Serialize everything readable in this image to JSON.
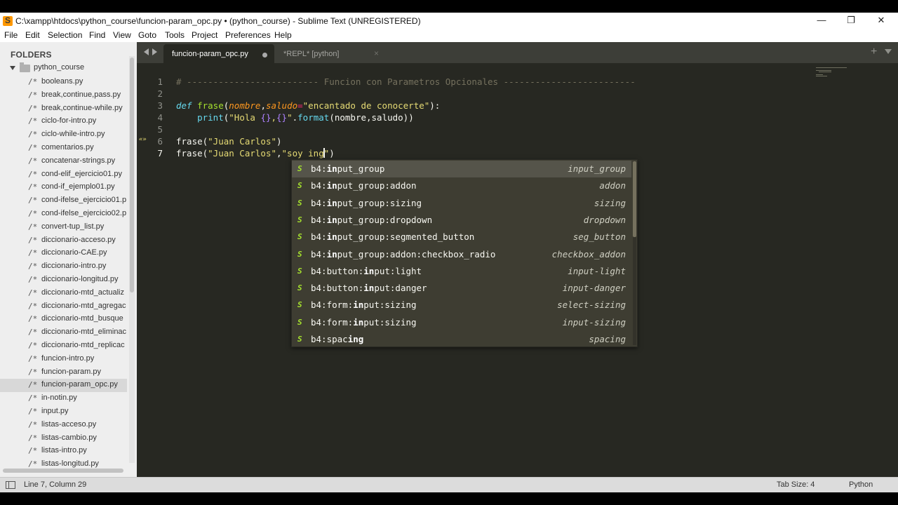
{
  "window": {
    "title": "C:\\xampp\\htdocs\\python_course\\funcion-param_opc.py • (python_course) - Sublime Text (UNREGISTERED)",
    "minimize_glyph": "—",
    "restore_glyph": "❐",
    "close_glyph": "✕"
  },
  "menu": [
    "File",
    "Edit",
    "Selection",
    "Find",
    "View",
    "Goto",
    "Tools",
    "Project",
    "Preferences",
    "Help"
  ],
  "sidebar": {
    "heading": "FOLDERS",
    "project": "python_course",
    "file_glyph": "/*",
    "selected_index": 23,
    "files": [
      "booleans.py",
      "break,continue,pass.py",
      "break,continue-while.py",
      "ciclo-for-intro.py",
      "ciclo-while-intro.py",
      "comentarios.py",
      "concatenar-strings.py",
      "cond-elif_ejercicio01.py",
      "cond-if_ejemplo01.py",
      "cond-ifelse_ejercicio01.p",
      "cond-ifelse_ejercicio02.p",
      "convert-tup_list.py",
      "diccionario-acceso.py",
      "diccionario-CAE.py",
      "diccionario-intro.py",
      "diccionario-longitud.py",
      "diccionario-mtd_actualiz",
      "diccionario-mtd_agregac",
      "diccionario-mtd_busque",
      "diccionario-mtd_eliminac",
      "diccionario-mtd_replicac",
      "funcion-intro.py",
      "funcion-param.py",
      "funcion-param_opc.py",
      "in-notin.py",
      "input.py",
      "listas-acceso.py",
      "listas-cambio.py",
      "listas-intro.py",
      "listas-longitud.py"
    ]
  },
  "tabs": [
    {
      "label": "funcion-param_opc.py",
      "active": true,
      "dirty": true
    },
    {
      "label": "*REPL* [python]",
      "active": false,
      "close_glyph": "×"
    }
  ],
  "tabbar": {
    "new_tab_glyph": "+"
  },
  "editor": {
    "current_line": 7,
    "gutter_marker": "«»",
    "line_numbers": [
      "1",
      "2",
      "3",
      "4",
      "5",
      "6",
      "7"
    ],
    "lines": {
      "l1": "# ------------------------- Funcion con Parametros Opcionales -------------------------",
      "l3_def": "def",
      "l3_name": "frase",
      "l3_open": "(",
      "l3_p1": "nombre",
      "l3_comma": ",",
      "l3_p2": "saludo",
      "l3_eq": "=",
      "l3_str": "\"encantado de conocerte\"",
      "l3_close": "):",
      "l4_indent": "    ",
      "l4_print": "print",
      "l4_open": "(",
      "l4_str_a": "\"Hola ",
      "l4_ph1": "{}",
      "l4_comma_s": ",",
      "l4_ph2": "{}",
      "l4_str_b": "\"",
      "l4_dot": ".",
      "l4_format": "format",
      "l4_args": "(nombre,saludo))",
      "l6_call": "frase(",
      "l6_str": "\"Juan Carlos\"",
      "l6_close": ")",
      "l7_call": "frase(",
      "l7_str1": "\"Juan Carlos\"",
      "l7_comma": ",",
      "l7_str2_a": "\"soy ing",
      "l7_str2_b": "\"",
      "l7_close": ")"
    }
  },
  "autocomplete": {
    "kind": "S",
    "selected_index": 0,
    "items": [
      {
        "pre": "b4:",
        "bold": "in",
        "post": "put_group",
        "desc": "input_group"
      },
      {
        "pre": "b4:",
        "bold": "in",
        "post": "put_group:addon",
        "desc": "addon"
      },
      {
        "pre": "b4:",
        "bold": "in",
        "post": "put_group:sizing",
        "desc": "sizing"
      },
      {
        "pre": "b4:",
        "bold": "in",
        "post": "put_group:dropdown",
        "desc": "dropdown"
      },
      {
        "pre": "b4:",
        "bold": "in",
        "post": "put_group:segmented_button",
        "desc": "seg_button"
      },
      {
        "pre": "b4:",
        "bold": "in",
        "post": "put_group:addon:checkbox_radio",
        "desc": "checkbox_addon"
      },
      {
        "pre": "b4:button:",
        "bold": "in",
        "post": "put:light",
        "desc": "input-light"
      },
      {
        "pre": "b4:button:",
        "bold": "in",
        "post": "put:danger",
        "desc": "input-danger"
      },
      {
        "pre": "b4:form:",
        "bold": "in",
        "post": "put:sizing",
        "desc": "select-sizing"
      },
      {
        "pre": "b4:form:",
        "bold": "in",
        "post": "put:sizing",
        "desc": "input-sizing"
      },
      {
        "pre": "b4:spac",
        "bold": "ing",
        "post": "",
        "desc": "spacing"
      }
    ]
  },
  "statusbar": {
    "position": "Line 7, Column 29",
    "tab_size": "Tab Size: 4",
    "syntax": "Python"
  },
  "colors": {
    "editor_bg": "#272822",
    "comment": "#75715e",
    "keyword": "#66d9ef",
    "function": "#a6e22e",
    "parameter": "#fd971f",
    "operator": "#f92672",
    "string": "#e6db74",
    "placeholder": "#ae81ff",
    "sidebar_bg": "#eeeeee",
    "accent_app": "#ff9800"
  },
  "icons": {
    "app": "sublime-text-icon",
    "folder": "folder-icon",
    "file": "file-comment-icon",
    "snippet": "snippet-icon",
    "panel": "panel-toggle-icon"
  }
}
